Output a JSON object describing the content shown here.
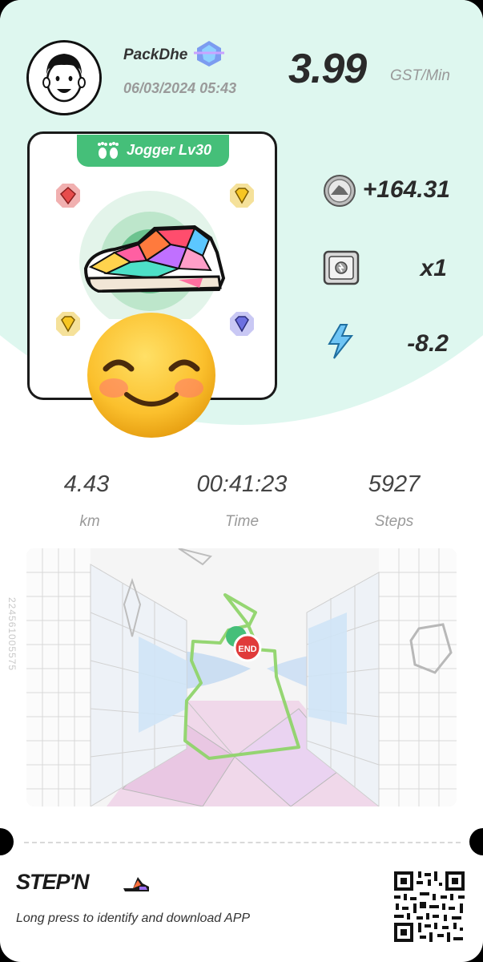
{
  "user": {
    "name": "PackDhe",
    "datetime": "06/03/2024 05:43"
  },
  "rate": {
    "value": "3.99",
    "unit": "GST/Min"
  },
  "sneaker": {
    "level_label": "Jogger Lv30",
    "gems": [
      "red-gem-icon",
      "yellow-gem-icon",
      "yellow-gem-icon",
      "purple-gem-icon"
    ]
  },
  "stats": [
    {
      "icon": "sneaker-coin-icon",
      "value": "+164.31"
    },
    {
      "icon": "mystery-box-icon",
      "value": "x1"
    },
    {
      "icon": "energy-bolt-icon",
      "value": "-8.2"
    }
  ],
  "metrics": [
    {
      "value": "4.43",
      "label": "km"
    },
    {
      "value": "00:41:23",
      "label": "Time"
    },
    {
      "value": "5927",
      "label": "Steps"
    }
  ],
  "map": {
    "end_label": "END"
  },
  "side_code": "224561005575",
  "footer": {
    "logo": "STEP'N",
    "tagline": "Long press to identify and download APP"
  },
  "colors": {
    "mint": "#def7ef",
    "green": "#45bf79",
    "route": "#8fd46a",
    "end_red": "#e03a3a"
  }
}
